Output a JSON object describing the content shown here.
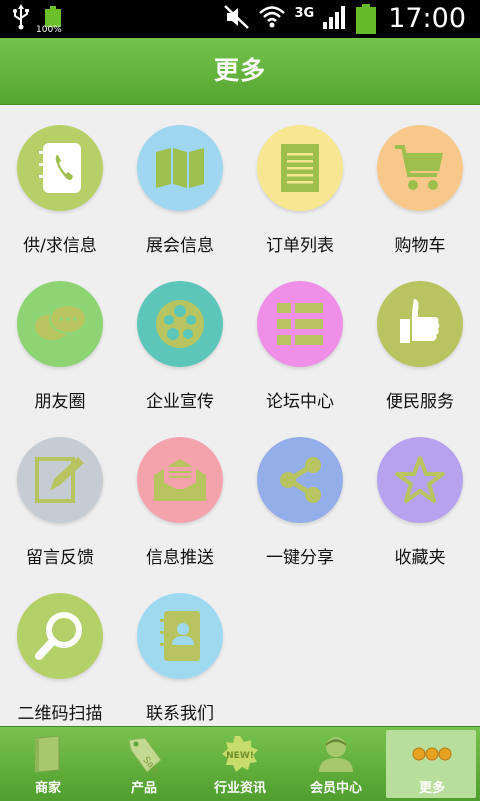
{
  "status_bar": {
    "battery_small_label": "100%",
    "network_label": "3G",
    "time": "17:00"
  },
  "header": {
    "title": "更多"
  },
  "menu": [
    {
      "label": "供/求信息",
      "icon": "address-book-phone-icon",
      "color": "#b6cf66"
    },
    {
      "label": "展会信息",
      "icon": "map-icon",
      "color": "#9fd7f0"
    },
    {
      "label": "订单列表",
      "icon": "order-list-icon",
      "color": "#f6e790"
    },
    {
      "label": "购物车",
      "icon": "shopping-cart-icon",
      "color": "#f7c88a"
    },
    {
      "label": "朋友圈",
      "icon": "chat-bubbles-icon",
      "color": "#8fd474"
    },
    {
      "label": "企业宣传",
      "icon": "film-reel-icon",
      "color": "#5cc6b8"
    },
    {
      "label": "论坛中心",
      "icon": "forum-list-icon",
      "color": "#ef8fe8"
    },
    {
      "label": "便民服务",
      "icon": "thumbs-up-icon",
      "color": "#b8c45f"
    },
    {
      "label": "留言反馈",
      "icon": "edit-note-icon",
      "color": "#c6ccd4"
    },
    {
      "label": "信息推送",
      "icon": "envelope-icon",
      "color": "#f4a3ad"
    },
    {
      "label": "一键分享",
      "icon": "share-icon",
      "color": "#93aee8"
    },
    {
      "label": "收藏夹",
      "icon": "star-icon",
      "color": "#b6a2ee"
    },
    {
      "label": "二维码扫描",
      "icon": "magnifier-icon",
      "color": "#b4d069"
    },
    {
      "label": "联系我们",
      "icon": "contact-book-icon",
      "color": "#9fd9f0"
    }
  ],
  "tabs": [
    {
      "label": "商家",
      "icon": "book-icon",
      "active": false
    },
    {
      "label": "产品",
      "icon": "sale-tag-icon",
      "active": false
    },
    {
      "label": "行业资讯",
      "icon": "new-badge-icon",
      "active": false
    },
    {
      "label": "会员中心",
      "icon": "member-avatar-icon",
      "active": false
    },
    {
      "label": "更多",
      "icon": "more-dots-icon",
      "active": true
    }
  ],
  "colors": {
    "header_green": "#5fae3a",
    "icon_green": "#9cbf4e"
  }
}
